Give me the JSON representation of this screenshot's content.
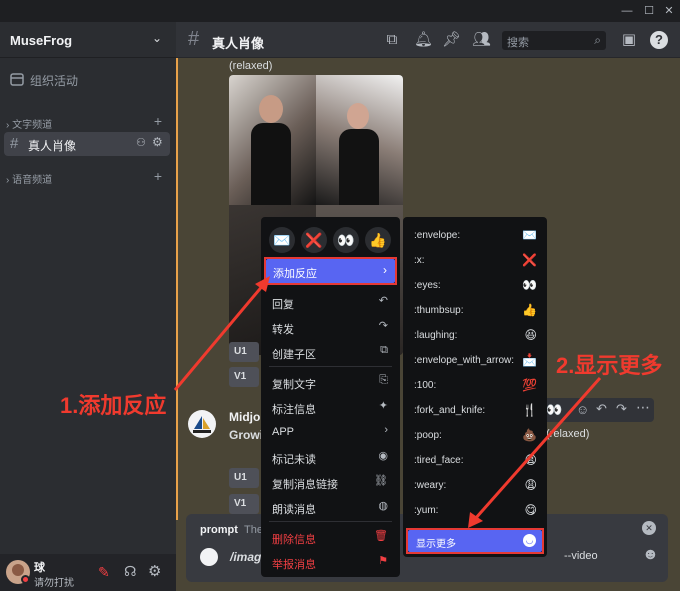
{
  "window": {
    "minimize": "—",
    "maximize": "☐",
    "close": "✕"
  },
  "sidebar": {
    "server_name": "MuseFrog",
    "events_label": "组织活动",
    "text_category": "文字频道",
    "active_channel": "真人肖像",
    "voice_category": "语音频道",
    "user_name": "球",
    "user_status": "请勿打扰"
  },
  "header": {
    "channel": "真人肖像",
    "search_placeholder": "搜索"
  },
  "messages": {
    "caption": "(relaxed)",
    "buttons_row1": [
      "U1"
    ],
    "buttons_row2": [
      "V1"
    ],
    "bot_name_partial": "Midjou",
    "bot_text_partial": "Growi",
    "bot_suffix": "(relaxed)",
    "buttons_row3": [
      "U1"
    ],
    "buttons_row4": [
      "V1"
    ]
  },
  "input": {
    "prompt_label": "prompt",
    "prompt_hint": "The",
    "command": "/imagi",
    "tail": "--video"
  },
  "context_menu": {
    "quick_reactions": [
      "✉️",
      "❌",
      "👀",
      "👍"
    ],
    "add_reaction": "添加反应",
    "items": [
      {
        "label": "回复",
        "icon": "reply-icon"
      },
      {
        "label": "转发",
        "icon": "forward-icon"
      },
      {
        "label": "创建子区",
        "icon": "thread-icon"
      },
      {
        "label": "复制文字",
        "icon": "copy-icon"
      },
      {
        "label": "标注信息",
        "icon": "pin-icon"
      },
      {
        "label": "APP",
        "icon": "chevron-right-icon"
      },
      {
        "label": "标记未读",
        "icon": "unread-icon"
      },
      {
        "label": "复制消息链接",
        "icon": "link-icon"
      },
      {
        "label": "朗读消息",
        "icon": "speak-icon"
      }
    ],
    "danger_items": [
      {
        "label": "删除信息",
        "icon": "trash-icon"
      },
      {
        "label": "举报消息",
        "icon": "flag-icon"
      }
    ]
  },
  "reaction_menu": {
    "items": [
      {
        "label": ":envelope:",
        "emoji": "✉️"
      },
      {
        "label": ":x:",
        "emoji": "❌"
      },
      {
        "label": ":eyes:",
        "emoji": "👀"
      },
      {
        "label": ":thumbsup:",
        "emoji": "👍"
      },
      {
        "label": ":laughing:",
        "emoji": "😆"
      },
      {
        "label": ":envelope_with_arrow:",
        "emoji": "📩"
      },
      {
        "label": ":100:",
        "emoji": "💯"
      },
      {
        "label": ":fork_and_knife:",
        "emoji": "🍴"
      },
      {
        "label": ":poop:",
        "emoji": "💩"
      },
      {
        "label": ":tired_face:",
        "emoji": "😫"
      },
      {
        "label": ":weary:",
        "emoji": "😩"
      },
      {
        "label": ":yum:",
        "emoji": "😋"
      }
    ],
    "show_more": "显示更多"
  },
  "annotations": {
    "step1": "1.添加反应",
    "step2": "2.显示更多"
  },
  "colors": {
    "accent": "#5865f2",
    "annotation_red": "#f03a2e",
    "menu_bg": "#111214",
    "danger": "#f23f43"
  }
}
